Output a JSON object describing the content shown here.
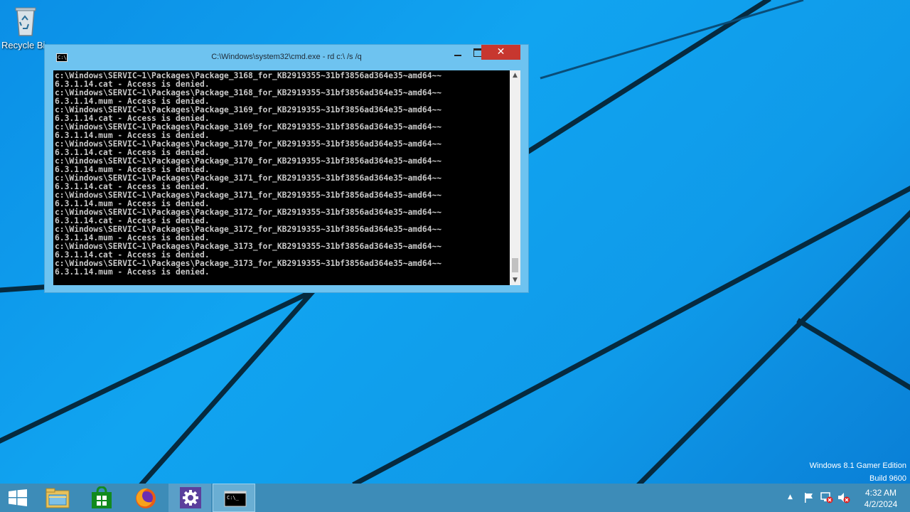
{
  "desktop": {
    "recycle_bin_label": "Recycle Bi",
    "watermark": {
      "edition": "Windows 8.1 Gamer Edition",
      "build": "Build 9600"
    }
  },
  "cmd_window": {
    "title": "C:\\Windows\\system32\\cmd.exe - rd  c:\\ /s /q",
    "close_label": "✕",
    "output": "c:\\Windows\\SERVIC~1\\Packages\\Package_3168_for_KB2919355~31bf3856ad364e35~amd64~~\n6.3.1.14.cat - Access is denied.\nc:\\Windows\\SERVIC~1\\Packages\\Package_3168_for_KB2919355~31bf3856ad364e35~amd64~~\n6.3.1.14.mum - Access is denied.\nc:\\Windows\\SERVIC~1\\Packages\\Package_3169_for_KB2919355~31bf3856ad364e35~amd64~~\n6.3.1.14.cat - Access is denied.\nc:\\Windows\\SERVIC~1\\Packages\\Package_3169_for_KB2919355~31bf3856ad364e35~amd64~~\n6.3.1.14.mum - Access is denied.\nc:\\Windows\\SERVIC~1\\Packages\\Package_3170_for_KB2919355~31bf3856ad364e35~amd64~~\n6.3.1.14.cat - Access is denied.\nc:\\Windows\\SERVIC~1\\Packages\\Package_3170_for_KB2919355~31bf3856ad364e35~amd64~~\n6.3.1.14.mum - Access is denied.\nc:\\Windows\\SERVIC~1\\Packages\\Package_3171_for_KB2919355~31bf3856ad364e35~amd64~~\n6.3.1.14.cat - Access is denied.\nc:\\Windows\\SERVIC~1\\Packages\\Package_3171_for_KB2919355~31bf3856ad364e35~amd64~~\n6.3.1.14.mum - Access is denied.\nc:\\Windows\\SERVIC~1\\Packages\\Package_3172_for_KB2919355~31bf3856ad364e35~amd64~~\n6.3.1.14.cat - Access is denied.\nc:\\Windows\\SERVIC~1\\Packages\\Package_3172_for_KB2919355~31bf3856ad364e35~amd64~~\n6.3.1.14.mum - Access is denied.\nc:\\Windows\\SERVIC~1\\Packages\\Package_3173_for_KB2919355~31bf3856ad364e35~amd64~~\n6.3.1.14.cat - Access is denied.\nc:\\Windows\\SERVIC~1\\Packages\\Package_3173_for_KB2919355~31bf3856ad364e35~amd64~~\n6.3.1.14.mum - Access is denied."
  },
  "taskbar": {
    "items": [
      {
        "name": "start",
        "icon": "windows-logo-icon"
      },
      {
        "name": "file-explorer",
        "icon": "folder-icon"
      },
      {
        "name": "store",
        "icon": "store-bag-icon"
      },
      {
        "name": "firefox",
        "icon": "firefox-icon"
      },
      {
        "name": "settings",
        "icon": "gear-icon"
      },
      {
        "name": "command-prompt",
        "icon": "cmd-icon"
      }
    ],
    "tray": {
      "time": "4:32 AM",
      "date": "4/2/2024"
    }
  },
  "colors": {
    "taskbar": "#3d8cb8",
    "close_button": "#c7372f",
    "window_frame": "#6ec3f0",
    "desktop": "#11a4f0"
  }
}
